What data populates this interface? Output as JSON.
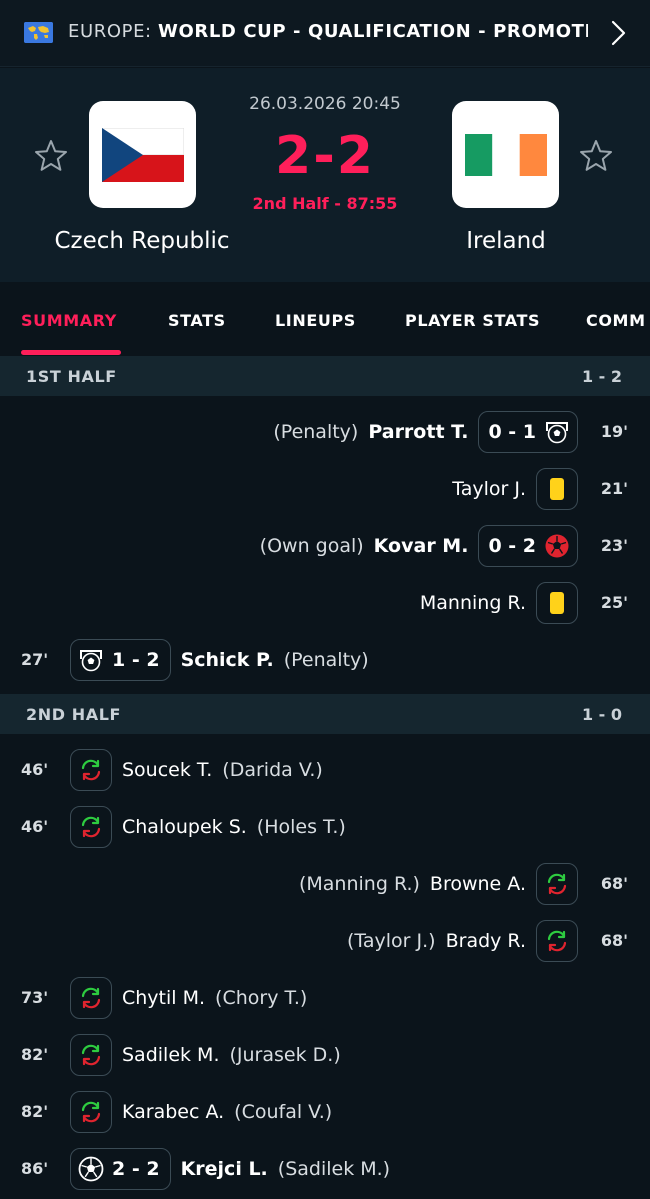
{
  "league": {
    "country": "EUROPE:",
    "competition": "WORLD CUP - QUALIFICATION - PROMOTION..."
  },
  "match": {
    "date": "26.03.2026 20:45",
    "score": "2-2",
    "status": "2nd Half - 87:55",
    "home_team": "Czech Republic",
    "away_team": "Ireland"
  },
  "tabs": [
    "SUMMARY",
    "STATS",
    "LINEUPS",
    "PLAYER STATS",
    "COMM"
  ],
  "sections": [
    {
      "label": "1ST HALF",
      "score": "1 - 2"
    },
    {
      "label": "2ND HALF",
      "score": "1 - 0"
    }
  ],
  "events": [
    {
      "side": "away",
      "minute": "19'",
      "type": "penalty-goal",
      "player": "Parrott T.",
      "detail": "(Penalty)",
      "score": "0 - 1"
    },
    {
      "side": "away",
      "minute": "21'",
      "type": "yellow-card",
      "player": "Taylor J."
    },
    {
      "side": "away",
      "minute": "23'",
      "type": "own-goal",
      "player": "Kovar M.",
      "detail": "(Own goal)",
      "score": "0 - 2"
    },
    {
      "side": "away",
      "minute": "25'",
      "type": "yellow-card",
      "player": "Manning R."
    },
    {
      "side": "home",
      "minute": "27'",
      "type": "penalty-goal",
      "player": "Schick P.",
      "detail": "(Penalty)",
      "score": "1 - 2"
    },
    {
      "side": "home",
      "minute": "46'",
      "type": "substitution",
      "player": "Soucek T.",
      "detail": "(Darida V.)"
    },
    {
      "side": "home",
      "minute": "46'",
      "type": "substitution",
      "player": "Chaloupek S.",
      "detail": "(Holes T.)"
    },
    {
      "side": "away",
      "minute": "68'",
      "type": "substitution",
      "player": "Browne A.",
      "detail": "(Manning R.)"
    },
    {
      "side": "away",
      "minute": "68'",
      "type": "substitution",
      "player": "Brady R.",
      "detail": "(Taylor J.)"
    },
    {
      "side": "home",
      "minute": "73'",
      "type": "substitution",
      "player": "Chytil M.",
      "detail": "(Chory T.)"
    },
    {
      "side": "home",
      "minute": "82'",
      "type": "substitution",
      "player": "Sadilek M.",
      "detail": "(Jurasek D.)"
    },
    {
      "side": "home",
      "minute": "82'",
      "type": "substitution",
      "player": "Karabec A.",
      "detail": "(Coufal V.)"
    },
    {
      "side": "home",
      "minute": "86'",
      "type": "goal",
      "player": "Krejci L.",
      "detail": "(Sadilek M.)",
      "score": "2 - 2"
    }
  ],
  "colors": {
    "accent": "#ff1f5a",
    "background": "#0b141b",
    "header_bg": "#0f1e28",
    "section_bg": "#15262f",
    "yellow_card": "#ffd21a",
    "own_goal_ball": "#e0242f"
  },
  "icons": {
    "league": "europe-flag-icon",
    "next": "chevron-right-icon",
    "favorite": "star-outline-icon",
    "goal": "soccer-ball-icon",
    "penalty": "penalty-goal-icon",
    "own_goal": "own-goal-ball-icon",
    "yellow_card": "yellow-card-icon",
    "substitution": "substitution-arrows-icon"
  }
}
